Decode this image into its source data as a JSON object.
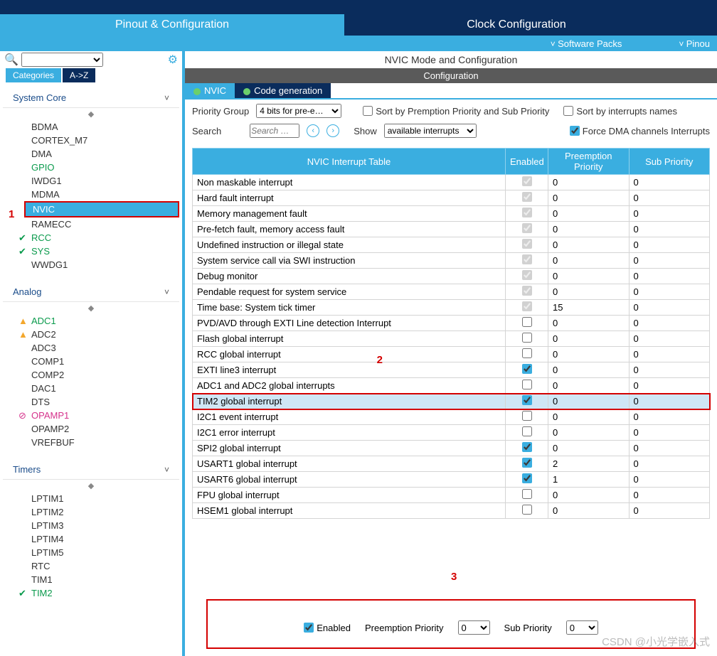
{
  "main_tabs": {
    "pinout": "Pinout & Configuration",
    "clock": "Clock Configuration"
  },
  "subtabs": {
    "packs": "Software Packs",
    "pinout": "Pinou"
  },
  "left": {
    "cat_tabs": {
      "cat": "Categories",
      "az": "A->Z"
    },
    "sections": {
      "system_core": "System Core",
      "analog": "Analog",
      "timers": "Timers"
    },
    "system_items": [
      "BDMA",
      "CORTEX_M7",
      "DMA",
      "GPIO",
      "IWDG1",
      "MDMA",
      "NVIC",
      "RAMECC",
      "RCC",
      "SYS",
      "WWDG1"
    ],
    "analog_items": [
      "ADC1",
      "ADC2",
      "ADC3",
      "COMP1",
      "COMP2",
      "DAC1",
      "DTS",
      "OPAMP1",
      "OPAMP2",
      "VREFBUF"
    ],
    "timer_items": [
      "LPTIM1",
      "LPTIM2",
      "LPTIM3",
      "LPTIM4",
      "LPTIM5",
      "RTC",
      "TIM1",
      "TIM2"
    ]
  },
  "right": {
    "mode_title": "NVIC Mode and Configuration",
    "config": "Configuration",
    "tabs": {
      "nvic": "NVIC",
      "codegen": "Code generation"
    },
    "filters": {
      "pg_label": "Priority Group",
      "pg_value": "4 bits for pre-e…",
      "sort_prio": "Sort by Premption Priority and Sub Priority",
      "sort_name": "Sort by interrupts names",
      "search_label": "Search",
      "search_ph": "Search …",
      "show_label": "Show",
      "show_value": "available interrupts",
      "force_dma": "Force DMA channels Interrupts"
    },
    "headers": {
      "name": "NVIC Interrupt Table",
      "en": "Enabled",
      "pp": "Preemption Priority",
      "sp": "Sub Priority"
    },
    "rows": [
      {
        "name": "Non maskable interrupt",
        "en": true,
        "gray": true,
        "pp": "0",
        "sp": "0"
      },
      {
        "name": "Hard fault interrupt",
        "en": true,
        "gray": true,
        "pp": "0",
        "sp": "0"
      },
      {
        "name": "Memory management fault",
        "en": true,
        "gray": true,
        "pp": "0",
        "sp": "0"
      },
      {
        "name": "Pre-fetch fault, memory access fault",
        "en": true,
        "gray": true,
        "pp": "0",
        "sp": "0"
      },
      {
        "name": "Undefined instruction or illegal state",
        "en": true,
        "gray": true,
        "pp": "0",
        "sp": "0"
      },
      {
        "name": "System service call via SWI instruction",
        "en": true,
        "gray": true,
        "pp": "0",
        "sp": "0"
      },
      {
        "name": "Debug monitor",
        "en": true,
        "gray": true,
        "pp": "0",
        "sp": "0"
      },
      {
        "name": "Pendable request for system service",
        "en": true,
        "gray": true,
        "pp": "0",
        "sp": "0"
      },
      {
        "name": "Time base: System tick timer",
        "en": true,
        "gray": true,
        "pp": "15",
        "sp": "0"
      },
      {
        "name": "PVD/AVD through EXTI Line detection Interrupt",
        "en": false,
        "gray": false,
        "pp": "0",
        "sp": "0"
      },
      {
        "name": "Flash global interrupt",
        "en": false,
        "gray": false,
        "pp": "0",
        "sp": "0"
      },
      {
        "name": "RCC global interrupt",
        "en": false,
        "gray": false,
        "pp": "0",
        "sp": "0"
      },
      {
        "name": "EXTI line3 interrupt",
        "en": true,
        "gray": false,
        "pp": "0",
        "sp": "0"
      },
      {
        "name": "ADC1 and ADC2 global interrupts",
        "en": false,
        "gray": false,
        "pp": "0",
        "sp": "0"
      },
      {
        "name": "TIM2 global interrupt",
        "en": true,
        "gray": false,
        "pp": "0",
        "sp": "0",
        "hl": true
      },
      {
        "name": "I2C1 event interrupt",
        "en": false,
        "gray": false,
        "pp": "0",
        "sp": "0"
      },
      {
        "name": "I2C1 error interrupt",
        "en": false,
        "gray": false,
        "pp": "0",
        "sp": "0"
      },
      {
        "name": "SPI2 global interrupt",
        "en": true,
        "gray": false,
        "pp": "0",
        "sp": "0"
      },
      {
        "name": "USART1 global interrupt",
        "en": true,
        "gray": false,
        "pp": "2",
        "sp": "0"
      },
      {
        "name": "USART6 global interrupt",
        "en": true,
        "gray": false,
        "pp": "1",
        "sp": "0"
      },
      {
        "name": "FPU global interrupt",
        "en": false,
        "gray": false,
        "pp": "0",
        "sp": "0"
      },
      {
        "name": "HSEM1 global interrupt",
        "en": false,
        "gray": false,
        "pp": "0",
        "sp": "0"
      }
    ],
    "bottom": {
      "enabled": "Enabled",
      "pp": "Preemption Priority",
      "pp_val": "0",
      "sp": "Sub Priority",
      "sp_val": "0"
    }
  },
  "markers": {
    "m1": "1",
    "m2": "2",
    "m3": "3"
  },
  "watermark": "CSDN @小光学嵌入式"
}
